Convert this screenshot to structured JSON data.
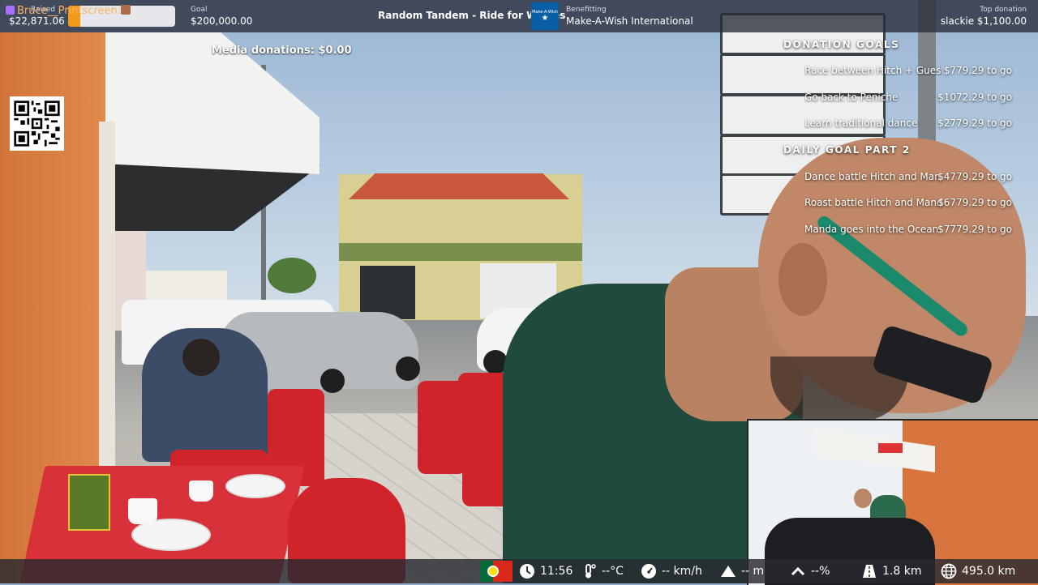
{
  "topbar": {
    "raised_label": "Raised",
    "raised_value": "$22,871.06",
    "progress_fraction": 0.114,
    "goal_label": "Goal",
    "goal_value": "$200,000.00",
    "stream_title": "Random Tandem - Ride for Wishes",
    "charity_logo_text": "Make-A-Wish",
    "benefitting_label": "Benefitting",
    "charity_name": "Make-A-Wish International",
    "top_donation_label": "Top donation",
    "top_donation_value": "slackie $1,100.00"
  },
  "media_donations": "Media donations: $0.00",
  "qr_icon": "qr-code",
  "goals": {
    "heading1": "DONATION GOALS",
    "items1": [
      {
        "name": "Race between Hitch + Guest",
        "amount": "$779.29 to go"
      },
      {
        "name": "Go back to Peniche",
        "amount": "$1072.29 to go"
      },
      {
        "name": "Learn traditional dance",
        "amount": "$2779.29 to go"
      }
    ],
    "heading2": "DAILY GOAL PART 2",
    "items2": [
      {
        "name": "Dance battle Hitch and Man...",
        "amount": "$4779.29 to go"
      },
      {
        "name": "Roast battle Hitch and Manda",
        "amount": "$6779.29 to go"
      },
      {
        "name": "Manda goes into the Ocean",
        "amount": "$7779.29 to go"
      }
    ]
  },
  "bottombar": {
    "chat_user": "Bruce__Printscreen:",
    "flag": "portugal-flag",
    "time": "11:56",
    "temperature": "--°C",
    "speed": "-- km/h",
    "altitude": "-- m",
    "incline": "--%",
    "distance_walk": "1.8 km",
    "distance_total": "495.0 km"
  },
  "colors": {
    "progress_fill": "#f29a19",
    "chat_name": "#ffb061",
    "bar_bg": "#262c38"
  }
}
